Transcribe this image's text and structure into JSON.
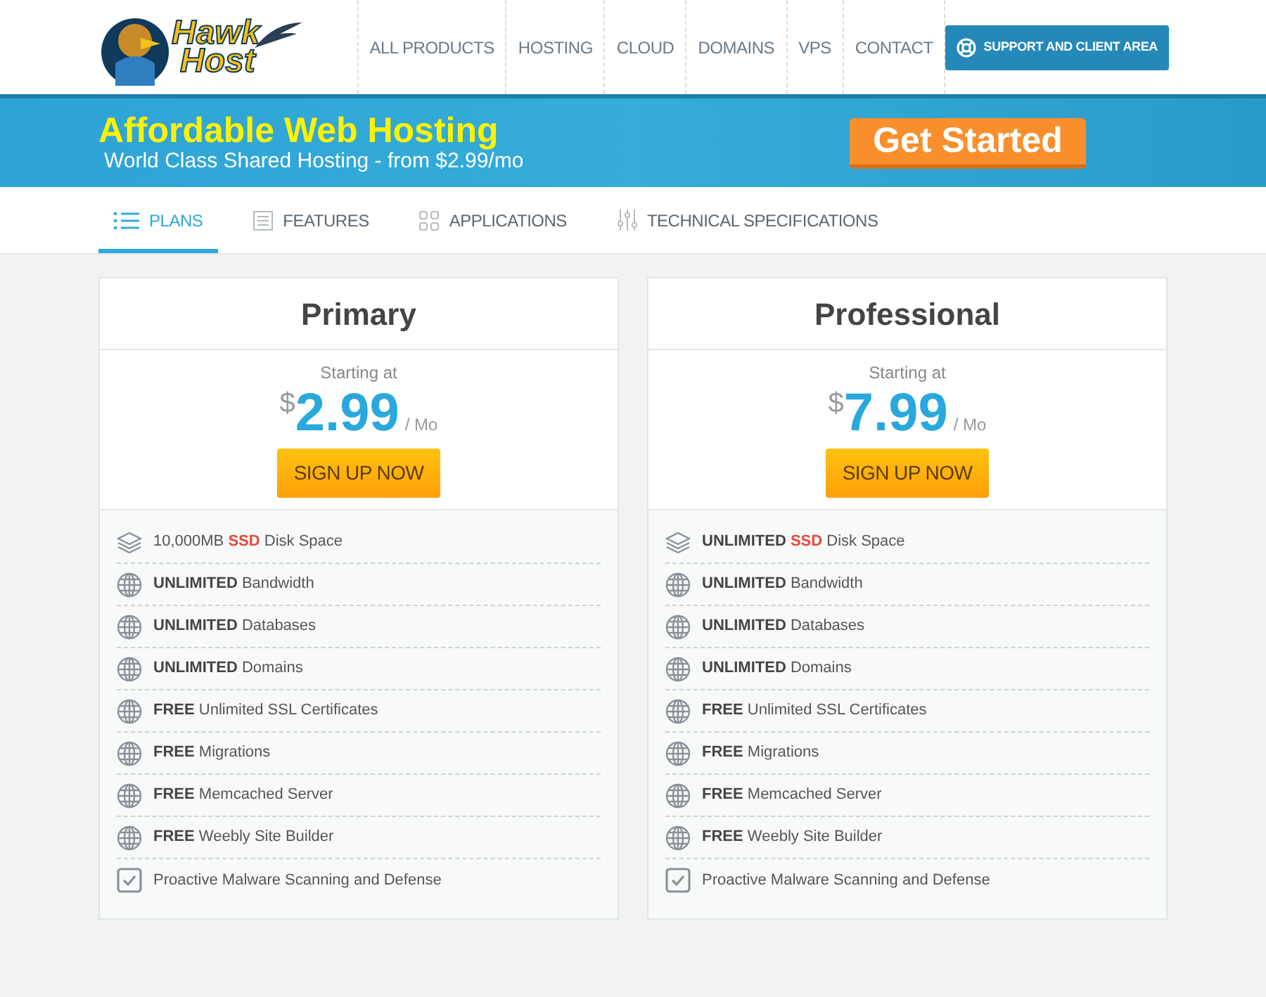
{
  "header": {
    "logo": {
      "line_1": "Hawk",
      "line_2": "Host"
    },
    "nav": [
      {
        "label": "ALL PRODUCTS"
      },
      {
        "label": "HOSTING"
      },
      {
        "label": "CLOUD"
      },
      {
        "label": "DOMAINS"
      },
      {
        "label": "VPS"
      },
      {
        "label": "CONTACT"
      }
    ],
    "support_button": "SUPPORT AND CLIENT AREA"
  },
  "banner": {
    "title": "Affordable Web Hosting",
    "subtitle": "World Class Shared Hosting - from $2.99/mo",
    "button": "Get Started"
  },
  "tabs": [
    {
      "label": "PLANS",
      "kind": "list",
      "selected": true
    },
    {
      "label": "FEATURES",
      "kind": "form",
      "selected": false
    },
    {
      "label": "APPLICATIONS",
      "kind": "grid",
      "selected": false
    },
    {
      "label": "TECHNICAL SPECIFICATIONS",
      "kind": "sliders",
      "selected": false
    }
  ],
  "plans": [
    {
      "name": "Primary",
      "starting": "Starting at",
      "currency": "$",
      "price": "2.99",
      "period": "/ Mo",
      "button": "SIGN UP NOW",
      "features": [
        {
          "kind": "layers",
          "parts": [
            {
              "text": "10,000MB"
            },
            {
              "text": "SSD",
              "kind": "highlight"
            },
            {
              "text": "Disk Space"
            }
          ]
        },
        {
          "kind": "globe",
          "parts": [
            {
              "text": "UNLIMITED",
              "kind": "bold"
            },
            {
              "text": "Bandwidth"
            }
          ]
        },
        {
          "kind": "globe",
          "parts": [
            {
              "text": "UNLIMITED",
              "kind": "bold"
            },
            {
              "text": "Databases"
            }
          ]
        },
        {
          "kind": "globe",
          "parts": [
            {
              "text": "UNLIMITED",
              "kind": "bold"
            },
            {
              "text": "Domains"
            }
          ]
        },
        {
          "kind": "globe",
          "parts": [
            {
              "text": "FREE",
              "kind": "bold"
            },
            {
              "text": "Unlimited SSL Certificates"
            }
          ]
        },
        {
          "kind": "globe",
          "parts": [
            {
              "text": "FREE",
              "kind": "bold"
            },
            {
              "text": "Migrations"
            }
          ]
        },
        {
          "kind": "globe",
          "parts": [
            {
              "text": "FREE",
              "kind": "bold"
            },
            {
              "text": "Memcached Server"
            }
          ]
        },
        {
          "kind": "globe",
          "parts": [
            {
              "text": "FREE",
              "kind": "bold"
            },
            {
              "text": "Weebly Site Builder"
            }
          ]
        },
        {
          "kind": "check",
          "parts": [
            {
              "text": "Proactive Malware Scanning and Defense"
            }
          ]
        }
      ]
    },
    {
      "name": "Professional",
      "starting": "Starting at",
      "currency": "$",
      "price": "7.99",
      "period": "/ Mo",
      "button": "SIGN UP NOW",
      "features": [
        {
          "kind": "layers",
          "parts": [
            {
              "text": "UNLIMITED",
              "kind": "bold"
            },
            {
              "text": "SSD",
              "kind": "highlight"
            },
            {
              "text": "Disk Space"
            }
          ]
        },
        {
          "kind": "globe",
          "parts": [
            {
              "text": "UNLIMITED",
              "kind": "bold"
            },
            {
              "text": "Bandwidth"
            }
          ]
        },
        {
          "kind": "globe",
          "parts": [
            {
              "text": "UNLIMITED",
              "kind": "bold"
            },
            {
              "text": "Databases"
            }
          ]
        },
        {
          "kind": "globe",
          "parts": [
            {
              "text": "UNLIMITED",
              "kind": "bold"
            },
            {
              "text": "Domains"
            }
          ]
        },
        {
          "kind": "globe",
          "parts": [
            {
              "text": "FREE",
              "kind": "bold"
            },
            {
              "text": "Unlimited SSL Certificates"
            }
          ]
        },
        {
          "kind": "globe",
          "parts": [
            {
              "text": "FREE",
              "kind": "bold"
            },
            {
              "text": "Migrations"
            }
          ]
        },
        {
          "kind": "globe",
          "parts": [
            {
              "text": "FREE",
              "kind": "bold"
            },
            {
              "text": "Memcached Server"
            }
          ]
        },
        {
          "kind": "globe",
          "parts": [
            {
              "text": "FREE",
              "kind": "bold"
            },
            {
              "text": "Weebly Site Builder"
            }
          ]
        },
        {
          "kind": "check",
          "parts": [
            {
              "text": "Proactive Malware Scanning and Defense"
            }
          ]
        }
      ]
    }
  ]
}
